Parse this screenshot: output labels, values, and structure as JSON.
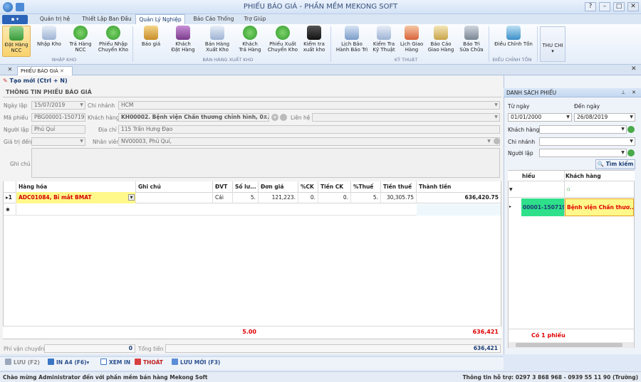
{
  "window": {
    "title": "PHIẾU BÁO GIÁ - PHẦN MỀM MEKONG SOFT"
  },
  "quick_access": {
    "file_button": "▪ ▾"
  },
  "ribbon_tabs": [
    {
      "label": "Quản trị hệ thống"
    },
    {
      "label": "Thiết Lập Ban Đầu"
    },
    {
      "label": "Quản Lý Nghiệp Vụ"
    },
    {
      "label": "Báo Cáo Thống Kê"
    },
    {
      "label": "Trợ Giúp"
    }
  ],
  "ribbon": {
    "nhapkho": {
      "group": "NHẬP KHO",
      "b1a": "Đặt Hàng",
      "b1b": "NCC",
      "b2a": "Nhập Kho",
      "b3a": "Trả Hàng",
      "b3b": "NCC",
      "b4a": "Phiếu Nhập",
      "b4b": "Chuyển Kho"
    },
    "banhang": {
      "group": "BÁN HÀNG XUẤT KHO",
      "b1a": "Báo giá",
      "b2a": "Khách",
      "b2b": "Đặt Hàng",
      "b3a": "Bán Hàng",
      "b3b": "Xuất Kho",
      "b4a": "Khách",
      "b4b": "Trả Hàng",
      "b5a": "Phiếu Xuất",
      "b5b": "Chuyển Kho",
      "b6a": "Kiểm tra",
      "b6b": "xuất kho"
    },
    "kythuat": {
      "group": "KỸ THUẬT",
      "b1a": "Lịch Bảo",
      "b1b": "Hành Bảo Trì",
      "b2a": "Kiểm Tra",
      "b2b": "Kỹ Thuật",
      "b3a": "Lịch Giao",
      "b3b": "Hàng",
      "b4a": "Báo Cáo",
      "b4b": "Giao Hàng",
      "b5a": "Báo Trì",
      "b5b": "Sửa Chữa"
    },
    "dieuchinh": {
      "group": "ĐIỀU CHỈNH TỒN",
      "b1a": "Điều Chỉnh Tồn"
    },
    "thuchi": {
      "label": "THU CHI",
      "arrow": "▾"
    }
  },
  "doc_tab": {
    "label": "PHIẾU BÁO GIÁ",
    "close": "✕"
  },
  "toolbar": {
    "new_label": "Tạo mới (Ctrl + N)"
  },
  "form": {
    "section_title": "THÔNG TIN PHIẾU BÁO GIÁ",
    "ngay_lap_label": "Ngày lập",
    "ngay_lap": "15/07/2019",
    "chi_nhanh_label": "Chi nhánh",
    "chi_nhanh": "HCM",
    "ma_phieu_label": "Mã phiếu",
    "ma_phieu": "PBG00001-150719",
    "khach_hang_label": "Khách hàng",
    "khach_hang": "KH00002. Bệnh viện Chấn thương chỉnh hình, 0...",
    "lien_he_label": "Liên hệ",
    "nguoi_lap_label": "Người lập",
    "nguoi_lap": "Phú Quí",
    "dia_chi_label": "Địa chỉ",
    "dia_chi": "115 Trần Hưng Đạo",
    "gia_tri_den_label": "Giá trị đến",
    "nhan_vien_label": "Nhân viên",
    "nhan_vien": "NV00003, Phú Quí,",
    "ghi_chu_label": "Ghi chú"
  },
  "grid": {
    "headers": [
      "Hàng hóa",
      "Ghi chú",
      "ĐVT",
      "Số lư...",
      "Đơn giá",
      "%CK",
      "Tiền CK",
      "%Thuế",
      "Tiền thuế",
      "Thành tiền"
    ],
    "row1": {
      "index": "1",
      "hang_hoa": "ADC01084, Bỉ mắt  BMAT",
      "ghi_chu": "",
      "dvt": "Cái",
      "so_luong": "5.",
      "don_gia": "121,223.",
      "ck": "0.",
      "tien_ck": "0.",
      "thue": "5.",
      "tien_thue": "30,305.75",
      "thanh_tien": "636,420.75"
    },
    "new_row_marker": "✱",
    "footer": {
      "total_qty": "5.00",
      "total_amount": "636,421"
    }
  },
  "bottom": {
    "phi_vc_label": "Phí vận chuyển",
    "phi_vc": "0",
    "tong_tien_label": "Tổng tiền",
    "tong_tien": "636,421"
  },
  "actions": {
    "luu": "LƯU (F2)",
    "in_a4": "IN A4 (F6)",
    "xem_in": "XEM IN",
    "thoat": "THOÁT",
    "luu_moi": "LƯU MỚI (F3)"
  },
  "side": {
    "title": "DANH SÁCH PHIẾU",
    "tu_ngay_label": "Từ ngày",
    "tu_ngay": "01/01/2000",
    "den_ngay_label": "Đến ngày",
    "den_ngay": "26/08/2019",
    "kh_label": "Khách hàng",
    "cn_label": "Chi nhánh",
    "nl_label": "Người lập",
    "search_btn": "Tìm kiếm",
    "col1": "hiếu",
    "col2": "Khách hàng",
    "row_phieu": "00001-150719",
    "row_kh": "Bệnh viện Chấn thươ...",
    "count": "Có 1 phiếu"
  },
  "status": {
    "left": "Chào mừng Administrator đến với phần mềm bán hàng Mekong Soft",
    "right": "Thông tin hỗ trợ: 0297 3 868 968 - 0939 55 11 90 (Trường)"
  }
}
